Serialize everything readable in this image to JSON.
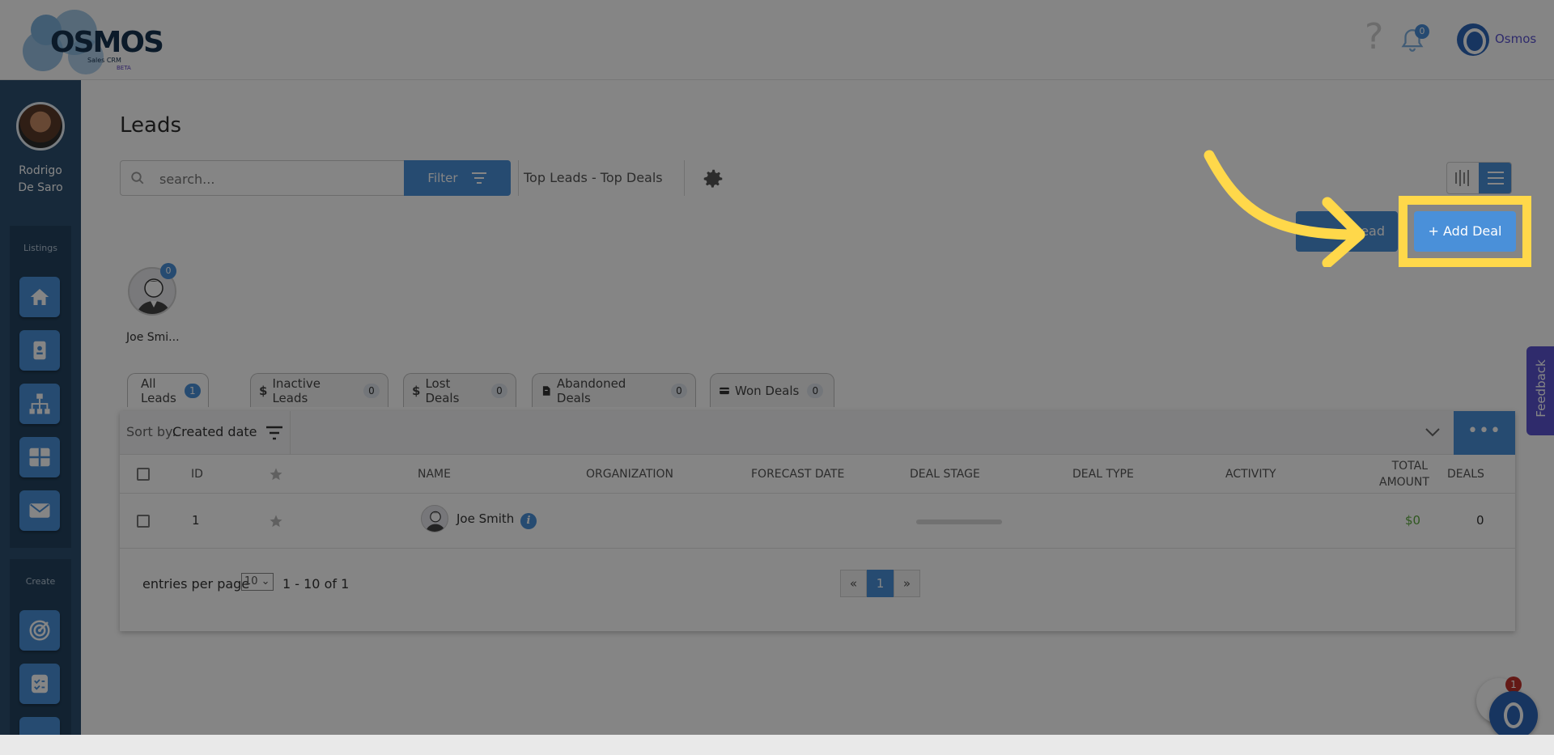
{
  "header": {
    "logo_word": "OSMOS",
    "logo_sub": "Sales CRM",
    "logo_beta": "BETA",
    "help_icon": "help-icon",
    "notifications_count": "0",
    "user_name": "Osmos"
  },
  "sidebar": {
    "user_first": "Rodrigo",
    "user_last": "De Saro",
    "listings_label": "Listings",
    "create_label": "Create",
    "listing_items": [
      "home-icon",
      "contact-card-icon",
      "org-chart-icon",
      "dashboard-grid-icon",
      "mail-icon"
    ],
    "create_items": [
      "target-icon",
      "checklist-icon"
    ]
  },
  "main": {
    "title": "Leads",
    "search": {
      "placeholder": "search..."
    },
    "filter_label": "Filter",
    "view_name": "Top Leads - Top Deals",
    "add_lead_label": "Lead",
    "add_deal_label": "+ Add Deal",
    "user_chip": {
      "name": "Joe Smi...",
      "count": "0"
    },
    "tabs": [
      {
        "label": "All Leads",
        "count": "1",
        "icon": "user-icon"
      },
      {
        "label": "Inactive Leads",
        "count": "0",
        "icon": "dollar-icon"
      },
      {
        "label": "Lost Deals",
        "count": "0",
        "icon": "dollar-icon"
      },
      {
        "label": "Abandoned Deals",
        "count": "0",
        "icon": "document-icon"
      },
      {
        "label": "Won Deals",
        "count": "0",
        "icon": "card-icon"
      }
    ],
    "sort": {
      "label": "Sort by:",
      "value": "Created date"
    },
    "more_label": "•••",
    "columns": {
      "id": "ID",
      "name": "NAME",
      "organization": "ORGANIZATION",
      "forecast_date": "FORECAST DATE",
      "deal_stage": "DEAL STAGE",
      "deal_type": "DEAL TYPE",
      "activity": "ACTIVITY",
      "total_amount_1": "TOTAL",
      "total_amount_2": "AMOUNT",
      "deals": "DEALS"
    },
    "rows": [
      {
        "id": "1",
        "name": "Joe Smith",
        "amount": "$0",
        "deals": "0"
      }
    ],
    "pagination": {
      "entries_label": "entries per page",
      "per_page": "10",
      "range": "1 - 10 of 1",
      "prev": "«",
      "current": "1",
      "next": "»"
    }
  },
  "feedback_label": "Feedback",
  "chat_badge": "1",
  "colors": {
    "accent": "#4a90d9",
    "highlight": "#ffd84a",
    "sidebar": "#2c4f70"
  }
}
